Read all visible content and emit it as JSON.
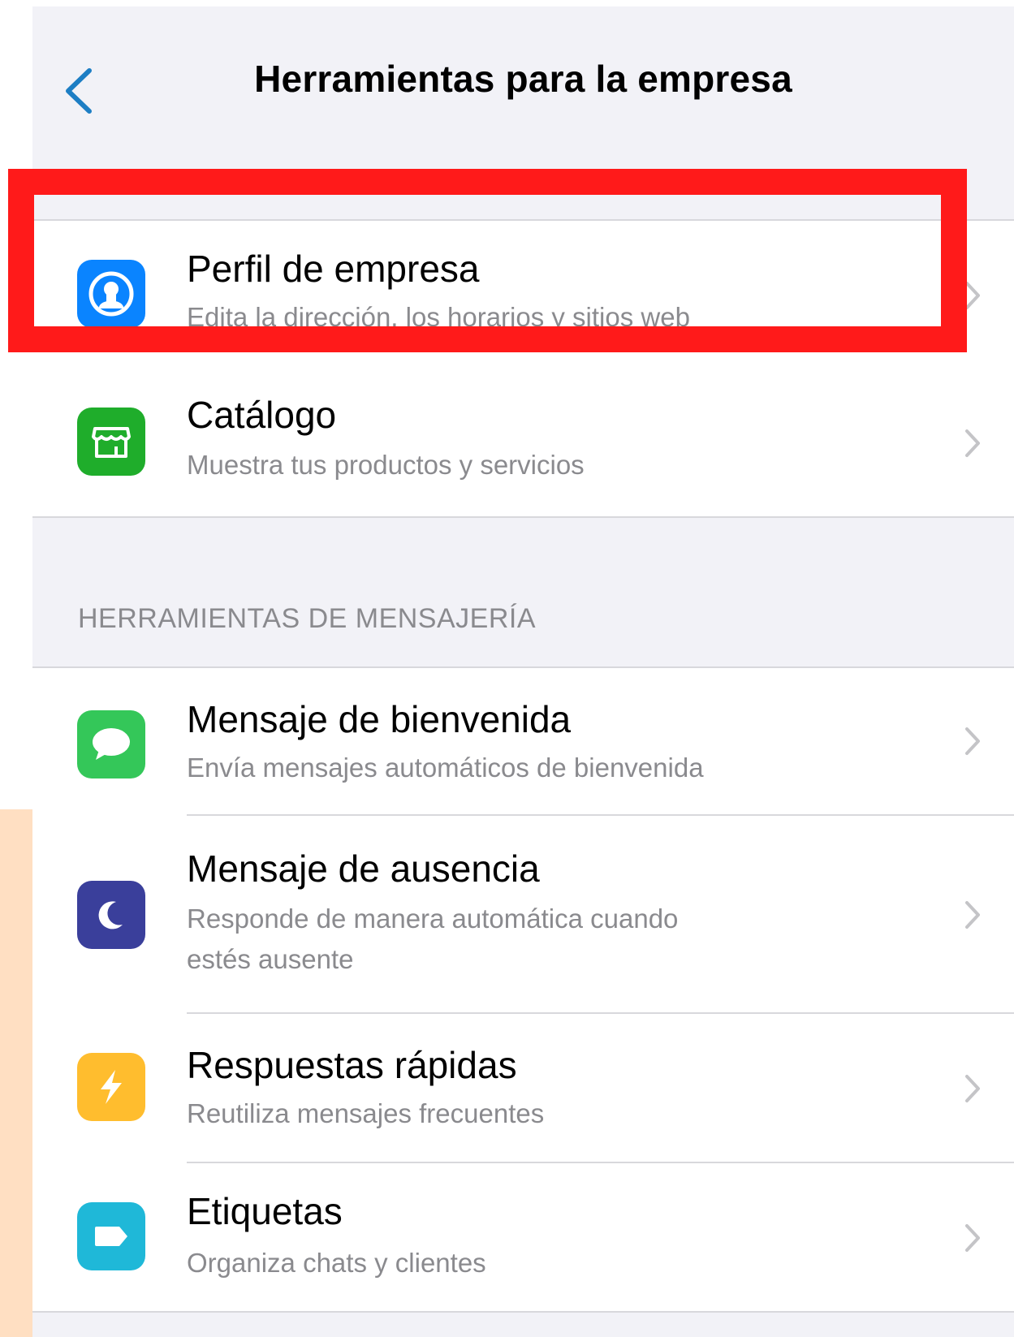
{
  "nav": {
    "title": "Herramientas para la empresa",
    "back_icon": "chevron-left-icon"
  },
  "colors": {
    "accent": "#1d7ec4",
    "highlight": "#ff1a1a",
    "peach": "#ffdfc2",
    "profile_icon_bg": "#0a84ff",
    "catalog_icon_bg": "#1fad2b",
    "welcome_icon_bg": "#34c759",
    "away_icon_bg": "#3a3f9b",
    "quick_icon_bg": "#ffbd2e",
    "labels_icon_bg": "#1fb8d8"
  },
  "business_group": [
    {
      "title": "Perfil de empresa",
      "subtitle": "Edita la dirección, los horarios y sitios web",
      "icon": "person-icon"
    },
    {
      "title": "Catálogo",
      "subtitle": "Muestra tus productos y servicios",
      "icon": "store-icon"
    }
  ],
  "messaging_section": {
    "header": "HERRAMIENTAS DE MENSAJERÍA",
    "items": [
      {
        "title": "Mensaje de bienvenida",
        "subtitle": "Envía mensajes automáticos de bienvenida",
        "icon": "chat-bubble-icon"
      },
      {
        "title": "Mensaje de ausencia",
        "subtitle": "Responde de manera automática cuando estés ausente",
        "icon": "moon-icon"
      },
      {
        "title": "Respuestas rápidas",
        "subtitle": "Reutiliza mensajes frecuentes",
        "icon": "lightning-icon"
      },
      {
        "title": "Etiquetas",
        "subtitle": "Organiza chats y clientes",
        "icon": "tag-icon"
      }
    ]
  }
}
